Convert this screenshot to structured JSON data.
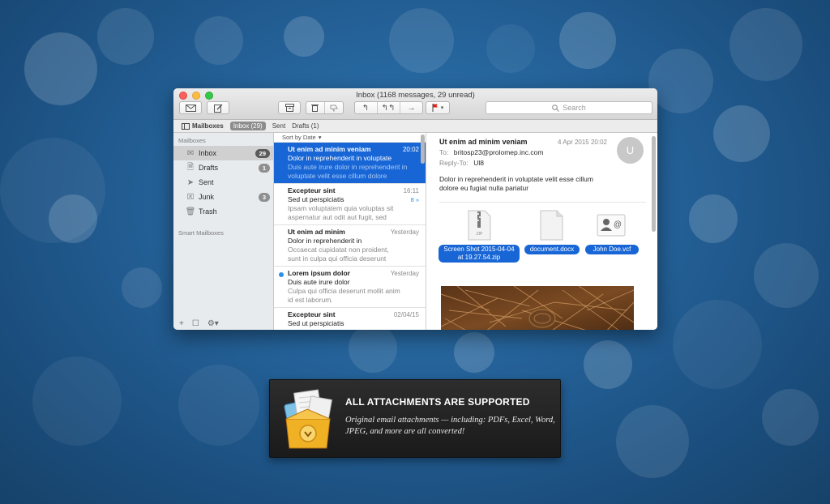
{
  "window": {
    "title": "Inbox (1168 messages, 29 unread)",
    "search_placeholder": "Search"
  },
  "favorites_bar": {
    "mailboxes": "Mailboxes",
    "inbox": "Inbox (29)",
    "sent": "Sent",
    "drafts": "Drafts (1)"
  },
  "sidebar": {
    "section_mailboxes": "Mailboxes",
    "items": [
      {
        "label": "Inbox",
        "badge": "29",
        "icon": "inbox-icon"
      },
      {
        "label": "Drafts",
        "badge": "1",
        "icon": "document-icon"
      },
      {
        "label": "Sent",
        "badge": "",
        "icon": "paper-plane-icon"
      },
      {
        "label": "Junk",
        "badge": "3",
        "icon": "junk-tray-icon"
      },
      {
        "label": "Trash",
        "badge": "",
        "icon": "trash-icon"
      }
    ],
    "section_smart": "Smart Mailboxes"
  },
  "message_list": {
    "sort_label": "Sort by Date",
    "messages": [
      {
        "from": "Ut enim ad minim veniam",
        "date": "20:02",
        "subject": "Dolor in reprehenderit in voluptate",
        "preview1": "Duis aute irure dolor in reprehenderit in",
        "preview2": "voluptate velit esse cillum dolore"
      },
      {
        "from": "Excepteur sint",
        "date": "16:11",
        "thread": "8 »",
        "subject": "Sed ut perspiciatis",
        "preview1": "Ipsam voluptatem quia voluptas sit",
        "preview2": "aspernatur aut odit aut fugit, sed"
      },
      {
        "from": "Ut enim ad minim",
        "date": "Yesterday",
        "subject": "Dolor in reprehenderit in",
        "preview1": "Occaecat cupidatat non proident,",
        "preview2": "sunt in culpa qui officia deserunt"
      },
      {
        "from": "Lorem ipsum dolor",
        "date": "Yesterday",
        "subject": "Duis aute irure dolor",
        "preview1": "Culpa qui officia deserunt mollit anim",
        "preview2": "id est laborum."
      },
      {
        "from": "Excepteur sint",
        "date": "02/04/15",
        "subject": "Sed ut perspiciatis",
        "preview1": "",
        "preview2": ""
      }
    ]
  },
  "reader": {
    "subject": "Ut enim ad minim veniam",
    "date": "4 Apr 2015 20:02",
    "to_label": "To:",
    "to": "britosp23@prolomep.inc.com",
    "reply_to_label": "Reply-To:",
    "reply_to": "Ul8",
    "body": "Dolor in reprehenderit in voluptate velit esse cillum dolore eu fugiat nulla pariatur",
    "avatar_initial": "U",
    "attachments": [
      {
        "name": "Screen Shot 2015-04-04 at 19.27.54.zip",
        "icon": "zip-file-icon"
      },
      {
        "name": "document.docx",
        "icon": "document-file-icon"
      },
      {
        "name": "John Doe.vcf",
        "icon": "contact-card-icon"
      }
    ]
  },
  "promo": {
    "title": "ALL ATTACHMENTS ARE SUPPORTED",
    "text": "Original email attachments — including: PDFs, Excel, Word, JPEG, and more are all converted!"
  },
  "colors": {
    "background": "#235f95",
    "selection": "#1866d6",
    "promo_bg": "#1f1f1f"
  }
}
